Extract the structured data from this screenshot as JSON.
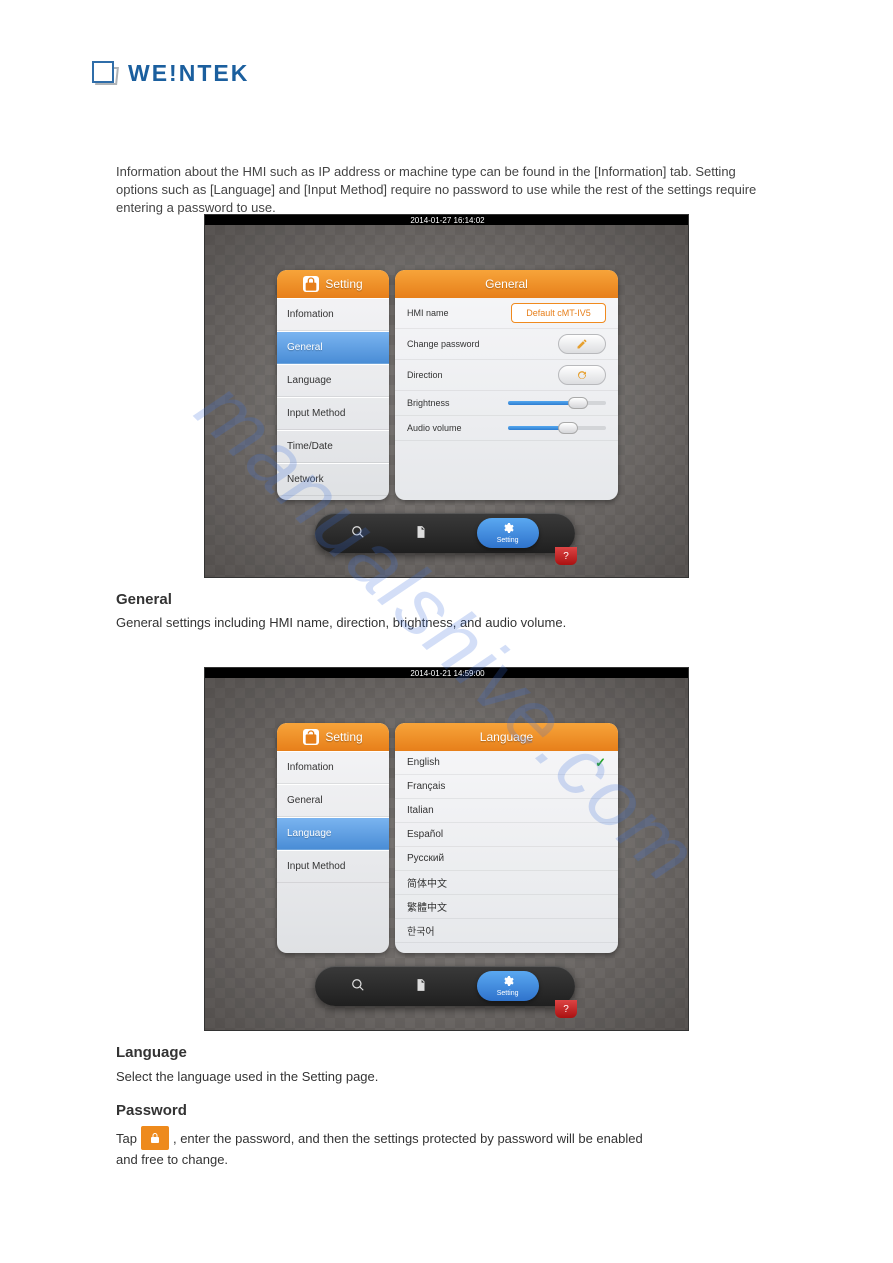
{
  "logo_text": "WE!NTEK",
  "watermark": "manualshive.com",
  "intro_text": "Information about the HMI such as IP address or machine type can be found in the [Information] tab. Setting options such as [Language] and [Input Method] require no password to use while the rest of the settings require entering a password to use.",
  "screenshot1": {
    "timestamp": "2014-01-27 16:14:02",
    "side_title": "Setting",
    "side_items": [
      "Infomation",
      "General",
      "Language",
      "Input Method",
      "Time/Date",
      "Network"
    ],
    "side_active_index": 1,
    "main_title": "General",
    "hmi_name_label": "HMI name",
    "hmi_name_value": "Default cMT-IV5",
    "change_pw_label": "Change password",
    "direction_label": "Direction",
    "brightness_label": "Brightness",
    "brightness_pct": 65,
    "audio_label": "Audio volume",
    "audio_pct": 55,
    "bottom_setting_label": "Setting"
  },
  "screenshot2": {
    "timestamp": "2014-01-21 14:59:00",
    "side_title": "Setting",
    "side_items": [
      "Infomation",
      "General",
      "Language",
      "Input Method"
    ],
    "side_active_index": 2,
    "main_title": "Language",
    "languages": [
      "English",
      "Français",
      "Italian",
      "Español",
      "Русский",
      "简体中文",
      "繁體中文",
      "한국어"
    ],
    "selected_index": 0,
    "bottom_setting_label": "Setting"
  },
  "labels": {
    "general": "General",
    "general_text": "General settings including HMI name, direction, brightness, and audio volume.",
    "language": "Language",
    "language_text": "Select the language used in the Setting page.",
    "password": "Password",
    "password_text_pre": "Tap",
    "password_text_post": ", enter the password, and then the settings protected by password will be enabled",
    "password_text_2": "and free to change."
  }
}
